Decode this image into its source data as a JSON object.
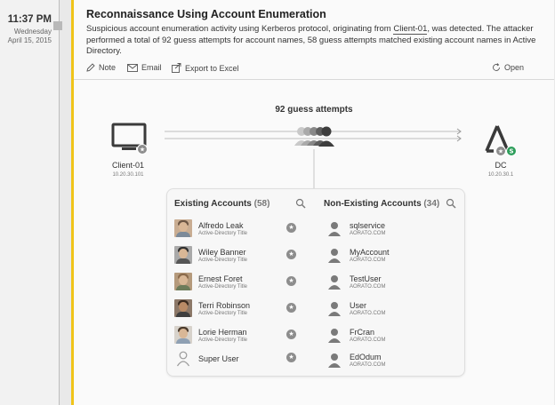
{
  "timeline": {
    "time": "11:37 PM",
    "day": "Wednesday",
    "date": "April 15, 2015"
  },
  "alert": {
    "title": "Reconnaissance Using Account Enumeration",
    "desc_part1": "Suspicious account enumeration activity using Kerberos protocol, originating from ",
    "desc_link": "Client-01",
    "desc_part2": ", was detected. The attacker performed a total of 92 guess attempts for account names, 58 guess attempts matched existing account names in Active Directory.",
    "accent_color": "#f0c419"
  },
  "actions": {
    "note": "Note",
    "email": "Email",
    "export": "Export to Excel",
    "open": "Open"
  },
  "diagram": {
    "attempts_label": "92 guess attempts",
    "source": {
      "name": "Client-01",
      "ip": "10.20.30.101"
    },
    "target": {
      "name": "DC",
      "ip": "10.20.30.1"
    }
  },
  "existing": {
    "title": "Existing Accounts",
    "count": "(58)",
    "items": [
      {
        "name": "Alfredo Leak",
        "sub": "Active-Directory Title",
        "avatar": "photo"
      },
      {
        "name": "Wiley Banner",
        "sub": "Active-Directory Title",
        "avatar": "photo"
      },
      {
        "name": "Ernest Foret",
        "sub": "Active-Directory Title",
        "avatar": "photo"
      },
      {
        "name": "Terri Robinson",
        "sub": "Active-Directory Title",
        "avatar": "photo"
      },
      {
        "name": "Lorie Herman",
        "sub": "Active-Directory Title",
        "avatar": "photo"
      },
      {
        "name": "Super User",
        "sub": "",
        "avatar": "generic-user-icon"
      }
    ]
  },
  "nonexisting": {
    "title": "Non-Existing Accounts",
    "count": "(34)",
    "items": [
      {
        "name": "sqlservice",
        "sub": "AORATO.COM"
      },
      {
        "name": "MyAccount",
        "sub": "AORATO.COM"
      },
      {
        "name": "TestUser",
        "sub": "AORATO.COM"
      },
      {
        "name": "User",
        "sub": "AORATO.COM"
      },
      {
        "name": "FrCran",
        "sub": "AORATO.COM"
      },
      {
        "name": "EdOdum",
        "sub": "AORATO.COM"
      }
    ]
  },
  "colors": {
    "accent": "#f0c419",
    "dc_badge": "#2e9e5b",
    "icon_gray": "#8d8d8d"
  }
}
